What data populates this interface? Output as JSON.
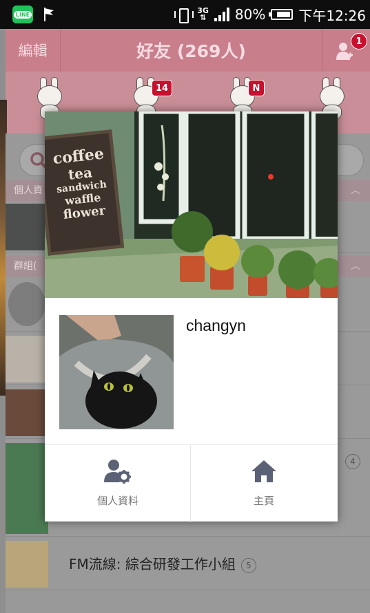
{
  "status_bar": {
    "app_icon": "line-app-icon",
    "network": "3G",
    "battery": "80%",
    "battery_level": 0.8,
    "time": "下午12:26"
  },
  "header": {
    "edit_label": "編輯",
    "title": "好友 (269人)",
    "add_badge": "1"
  },
  "stickers": {
    "badges": [
      "14",
      "N"
    ]
  },
  "list": {
    "section_personal": "個人資",
    "section_groups": "群組(",
    "group_rows": [
      {
        "count": "4"
      },
      {
        "name": "FM流線:  綜合研發工作小組",
        "count": "5"
      }
    ]
  },
  "profile_popup": {
    "cover_sign": [
      "coffee",
      "tea",
      "sandwich",
      "waffle",
      "flower"
    ],
    "username": "changyn",
    "actions": [
      {
        "icon": "profile-settings-icon",
        "label": "個人資料"
      },
      {
        "icon": "home-icon",
        "label": "主頁"
      }
    ]
  },
  "colors": {
    "header_pink": "#c97e8c",
    "icon_slate": "#5b6275",
    "line_green": "#21c35a",
    "badge_red": "#c8102e"
  }
}
